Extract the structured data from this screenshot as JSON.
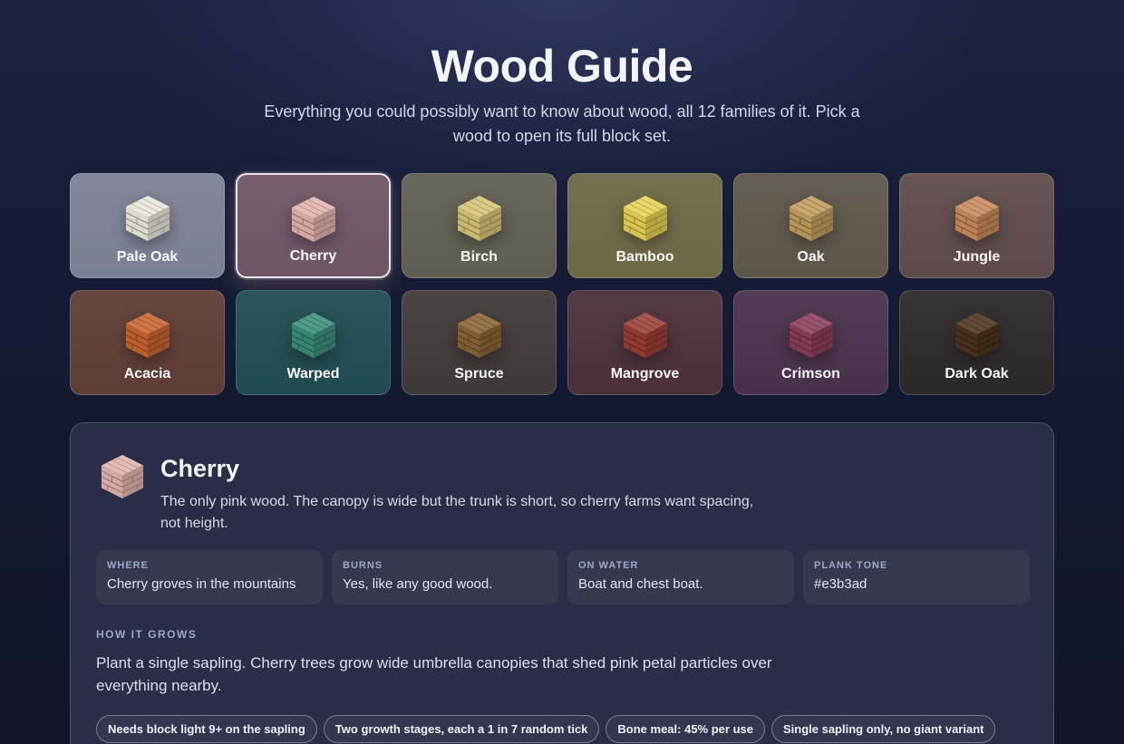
{
  "header": {
    "title": "Wood Guide",
    "subtitle": "Everything you could possibly want to know about wood, all 12 families of it. Pick a wood to open its full block set."
  },
  "woods": [
    {
      "name": "Pale Oak",
      "plank": "#ece6da",
      "bg": "#7a7f93"
    },
    {
      "name": "Cherry",
      "plank": "#e3b3ad",
      "bg": "#6d5565"
    },
    {
      "name": "Birch",
      "plank": "#d8c478",
      "bg": "#5e5d50"
    },
    {
      "name": "Bamboo",
      "plank": "#e8d254",
      "bg": "#6c6845"
    },
    {
      "name": "Oak",
      "plank": "#c29d5e",
      "bg": "#5c5548"
    },
    {
      "name": "Jungle",
      "plank": "#c98a5c",
      "bg": "#5c4a48"
    },
    {
      "name": "Acacia",
      "plank": "#c7642f",
      "bg": "#5c3c34"
    },
    {
      "name": "Warped",
      "plank": "#3a8e7a",
      "bg": "#1f4a4f"
    },
    {
      "name": "Spruce",
      "plank": "#8a6335",
      "bg": "#3e3836"
    },
    {
      "name": "Mangrove",
      "plank": "#9a3f33",
      "bg": "#4a2f38"
    },
    {
      "name": "Crimson",
      "plank": "#8a3d58",
      "bg": "#48304a"
    },
    {
      "name": "Dark Oak",
      "plank": "#4b321c",
      "bg": "#2b2729"
    }
  ],
  "selected": {
    "name": "Cherry",
    "description": "The only pink wood. The canopy is wide but the trunk is short, so cherry farms want spacing, not height.",
    "plank": "#e3b3ad",
    "stats": [
      {
        "label": "WHERE",
        "value": "Cherry groves in the mountains"
      },
      {
        "label": "BURNS",
        "value": "Yes, like any good wood."
      },
      {
        "label": "ON WATER",
        "value": "Boat and chest boat."
      },
      {
        "label": "PLANK TONE",
        "value": "#e3b3ad"
      }
    ],
    "grow_heading": "HOW IT GROWS",
    "grow_text": "Plant a single sapling. Cherry trees grow wide umbrella canopies that shed pink petal particles over everything nearby.",
    "chips": [
      "Needs block light 9+ on the sapling",
      "Two growth stages, each a 1 in 7 random tick",
      "Bone meal: 45% per use",
      "Single sapling only, no giant variant"
    ]
  }
}
